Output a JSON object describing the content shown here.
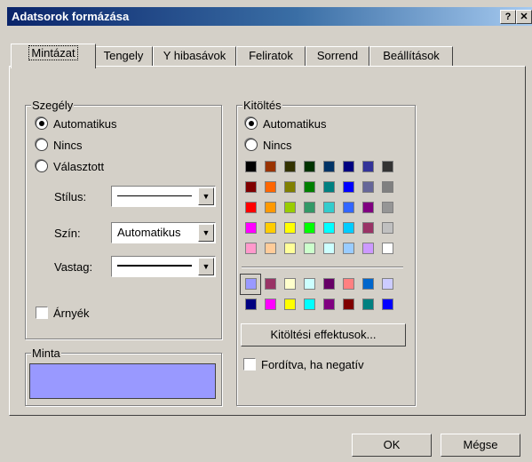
{
  "window": {
    "title": "Adatsorok formázása",
    "help_label": "?",
    "close_label": "✕"
  },
  "tabs": [
    {
      "label": "Mintázat",
      "active": true
    },
    {
      "label": "Tengely"
    },
    {
      "label": "Y hibasávok"
    },
    {
      "label": "Feliratok"
    },
    {
      "label": "Sorrend"
    },
    {
      "label": "Beállítások"
    }
  ],
  "border_group": {
    "title": "Szegély",
    "options": [
      {
        "label": "Automatikus",
        "selected": true
      },
      {
        "label": "Nincs"
      },
      {
        "label": "Választott"
      }
    ],
    "style_label": "Stílus:",
    "color_label": "Szín:",
    "color_value": "Automatikus",
    "weight_label": "Vastag:",
    "shadow_label": "Árnyék"
  },
  "sample_group": {
    "title": "Minta",
    "color": "#9999ff"
  },
  "fill_group": {
    "title": "Kitöltés",
    "options": [
      {
        "label": "Automatikus",
        "selected": true
      },
      {
        "label": "Nincs"
      }
    ],
    "palette_top": [
      [
        "#000000",
        "#993300",
        "#333300",
        "#003300",
        "#003366",
        "#000080",
        "#333399",
        "#333333"
      ],
      [
        "#800000",
        "#ff6600",
        "#808000",
        "#008000",
        "#008080",
        "#0000ff",
        "#666699",
        "#808080"
      ],
      [
        "#ff0000",
        "#ff9900",
        "#99cc00",
        "#339966",
        "#33cccc",
        "#3366ff",
        "#800080",
        "#969696"
      ],
      [
        "#ff00ff",
        "#ffcc00",
        "#ffff00",
        "#00ff00",
        "#00ffff",
        "#00ccff",
        "#993366",
        "#c0c0c0"
      ],
      [
        "#ff99cc",
        "#ffcc99",
        "#ffff99",
        "#ccffcc",
        "#ccffff",
        "#99ccff",
        "#cc99ff",
        "#ffffff"
      ]
    ],
    "palette_bottom": [
      [
        "#9999ff",
        "#993366",
        "#ffffcc",
        "#ccffff",
        "#660066",
        "#ff8080",
        "#0066cc",
        "#ccccff"
      ],
      [
        "#000080",
        "#ff00ff",
        "#ffff00",
        "#00ffff",
        "#800080",
        "#800000",
        "#008080",
        "#0000ff"
      ]
    ],
    "effects_button": "Kitöltési effektusok...",
    "invert_label": "Fordítva, ha negatív"
  },
  "buttons": {
    "ok": "OK",
    "cancel": "Mégse"
  }
}
